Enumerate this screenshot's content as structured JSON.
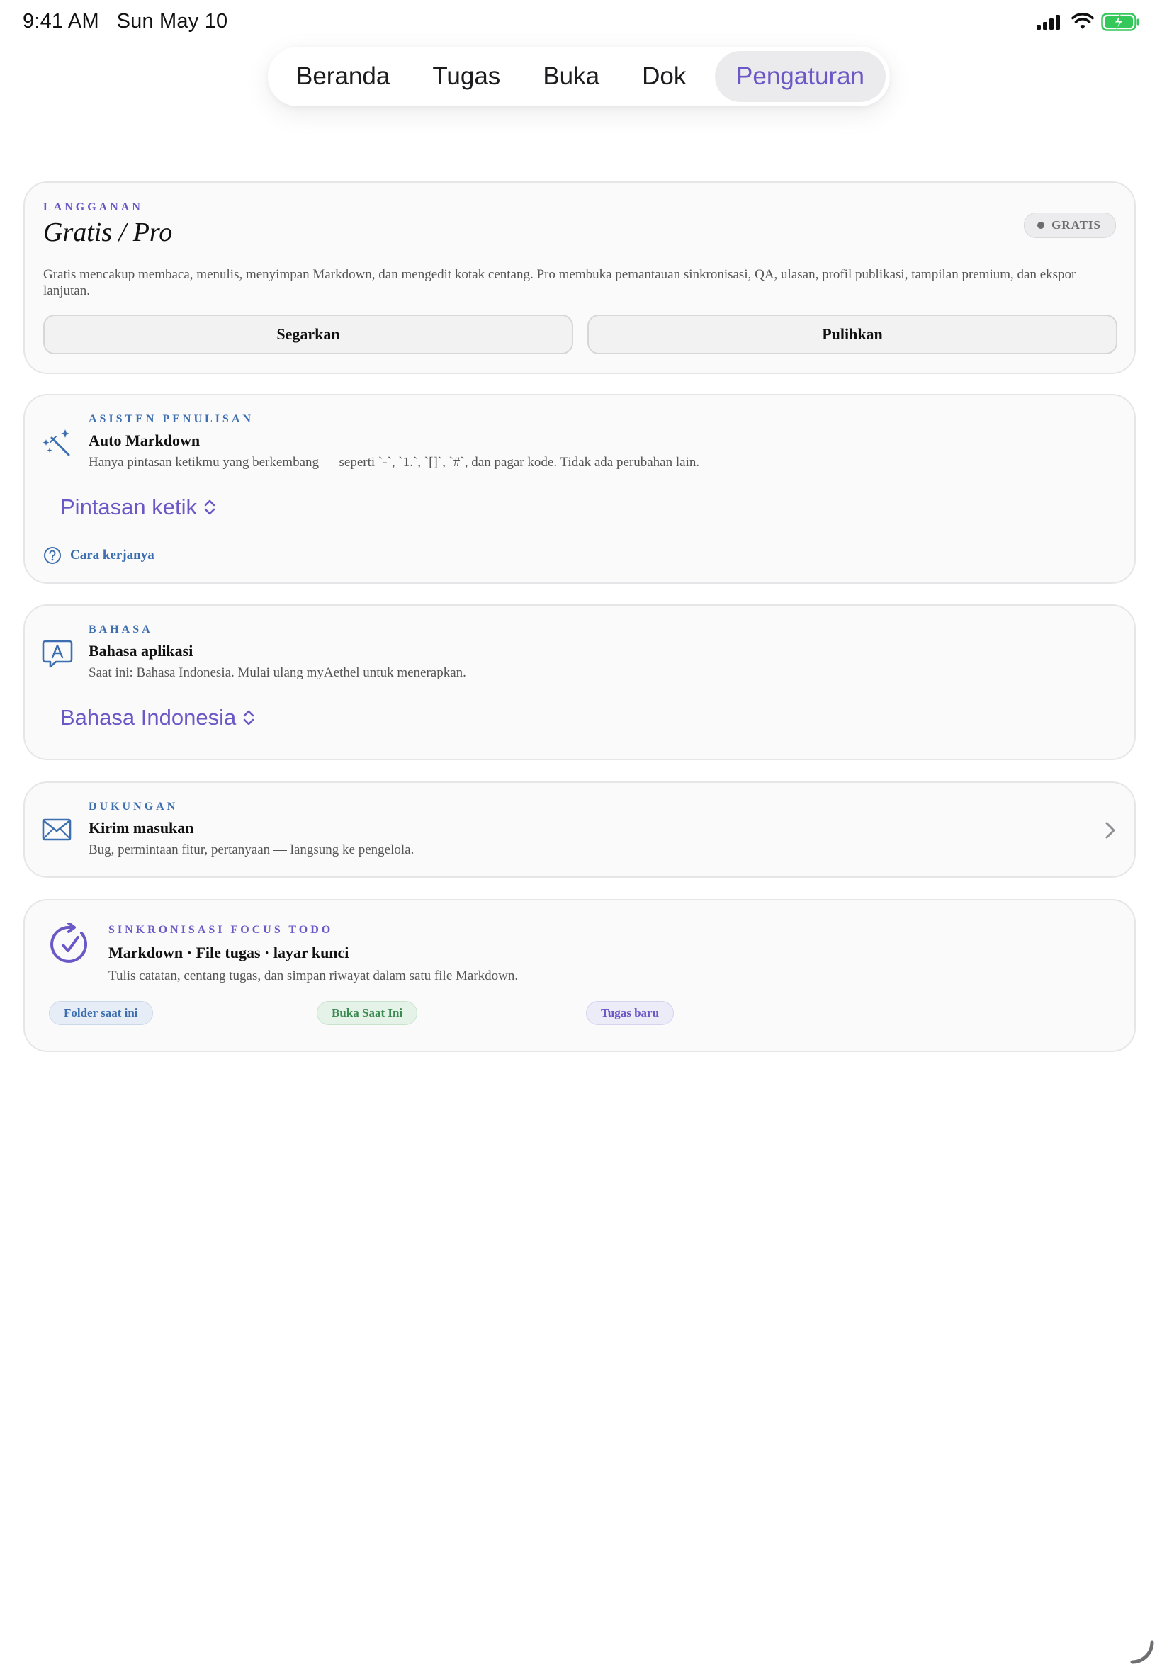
{
  "status_bar": {
    "time": "9:41 AM",
    "date": "Sun May 10",
    "icons": [
      "cellular-signal-icon",
      "wifi-icon",
      "battery-charging-icon"
    ]
  },
  "tabs": [
    {
      "label": "Beranda",
      "active": false
    },
    {
      "label": "Tugas",
      "active": false
    },
    {
      "label": "Buka",
      "active": false
    },
    {
      "label": "Dok",
      "active": false
    },
    {
      "label": "Pengaturan",
      "active": true
    }
  ],
  "subscription": {
    "eyebrow": "LANGGANAN",
    "title": "Gratis / Pro",
    "badge": "GRATIS",
    "description": "Gratis mencakup membaca, menulis, menyimpan Markdown, dan mengedit kotak centang. Pro membuka pemantauan sinkronisasi, QA, ulasan, profil publikasi, tampilan premium, dan ekspor lanjutan.",
    "refresh_label": "Segarkan",
    "restore_label": "Pulihkan"
  },
  "writing_assistant": {
    "eyebrow": "ASISTEN PENULISAN",
    "title": "Auto Markdown",
    "description": "Hanya pintasan ketikmu yang berkembang — seperti `-`, `1.`, `[]`, `#`, dan pagar kode. Tidak ada perubahan lain.",
    "picker_value": "Pintasan ketik",
    "help_link": "Cara kerjanya",
    "icon": "magic-wand-icon"
  },
  "language": {
    "eyebrow": "BAHASA",
    "title": "Bahasa aplikasi",
    "description": "Saat ini: Bahasa Indonesia. Mulai ulang myAethel untuk menerapkan.",
    "picker_value": "Bahasa Indonesia",
    "icon": "language-bubble-icon"
  },
  "support": {
    "eyebrow": "DUKUNGAN",
    "title": "Kirim masukan",
    "description": "Bug, permintaan fitur, pertanyaan — langsung ke pengelola.",
    "icon": "envelope-icon"
  },
  "sync": {
    "eyebrow": "SINKRONISASI FOCUS TODO",
    "title": "Markdown · File tugas · layar kunci",
    "description": "Tulis catatan, centang tugas, dan simpan riwayat dalam satu file Markdown.",
    "chips": [
      "Folder saat ini",
      "Buka Saat Ini",
      "Tugas baru"
    ],
    "icon": "sync-check-icon"
  },
  "colors": {
    "accent_purple": "#6b57c6",
    "accent_blue": "#3d6fb0",
    "accent_green": "#3b8a52",
    "battery_green": "#34c759"
  }
}
